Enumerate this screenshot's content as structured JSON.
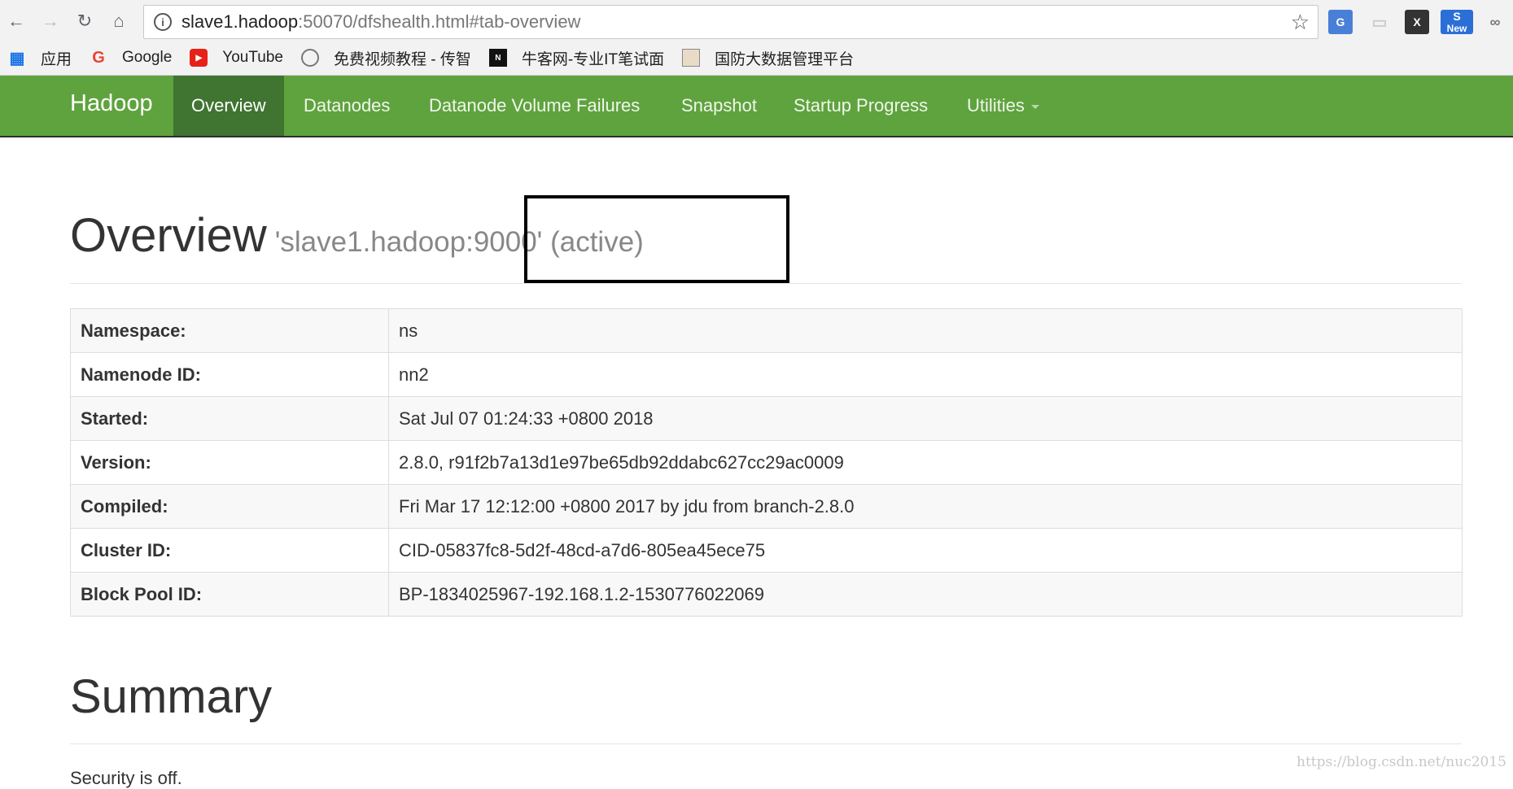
{
  "browser": {
    "url_host": "slave1.hadoop",
    "url_rest": ":50070/dfshealth.html#tab-overview",
    "extensions": [
      "New"
    ],
    "bookmarks": [
      {
        "label": "应用",
        "icon": "apps-grid-icon"
      },
      {
        "label": "Google",
        "icon": "google-icon"
      },
      {
        "label": "YouTube",
        "icon": "youtube-icon"
      },
      {
        "label": "免费视频教程 - 传智",
        "icon": "site-icon"
      },
      {
        "label": "牛客网-专业IT笔试面",
        "icon": "nowcoder-icon"
      },
      {
        "label": "国防大数据管理平台",
        "icon": "image-icon"
      }
    ]
  },
  "navbar": {
    "brand": "Hadoop",
    "items": [
      "Overview",
      "Datanodes",
      "Datanode Volume Failures",
      "Snapshot",
      "Startup Progress",
      "Utilities"
    ],
    "accent": "#5fa33e",
    "active_bg": "#3f7431"
  },
  "overview": {
    "title": "Overview",
    "subtitle": "'slave1.hadoop:9000' (active)",
    "rows": [
      {
        "key": "Namespace:",
        "value": "ns"
      },
      {
        "key": "Namenode ID:",
        "value": "nn2"
      },
      {
        "key": "Started:",
        "value": "Sat Jul 07 01:24:33 +0800 2018"
      },
      {
        "key": "Version:",
        "value": "2.8.0, r91f2b7a13d1e97be65db92ddabc627cc29ac0009"
      },
      {
        "key": "Compiled:",
        "value": "Fri Mar 17 12:12:00 +0800 2017 by jdu from branch-2.8.0"
      },
      {
        "key": "Cluster ID:",
        "value": "CID-05837fc8-5d2f-48cd-a7d6-805ea45ece75"
      },
      {
        "key": "Block Pool ID:",
        "value": "BP-1834025967-192.168.1.2-1530776022069"
      }
    ]
  },
  "summary": {
    "title": "Summary",
    "partial_text": "Security is off."
  },
  "watermark": "https://blog.csdn.net/nuc2015"
}
